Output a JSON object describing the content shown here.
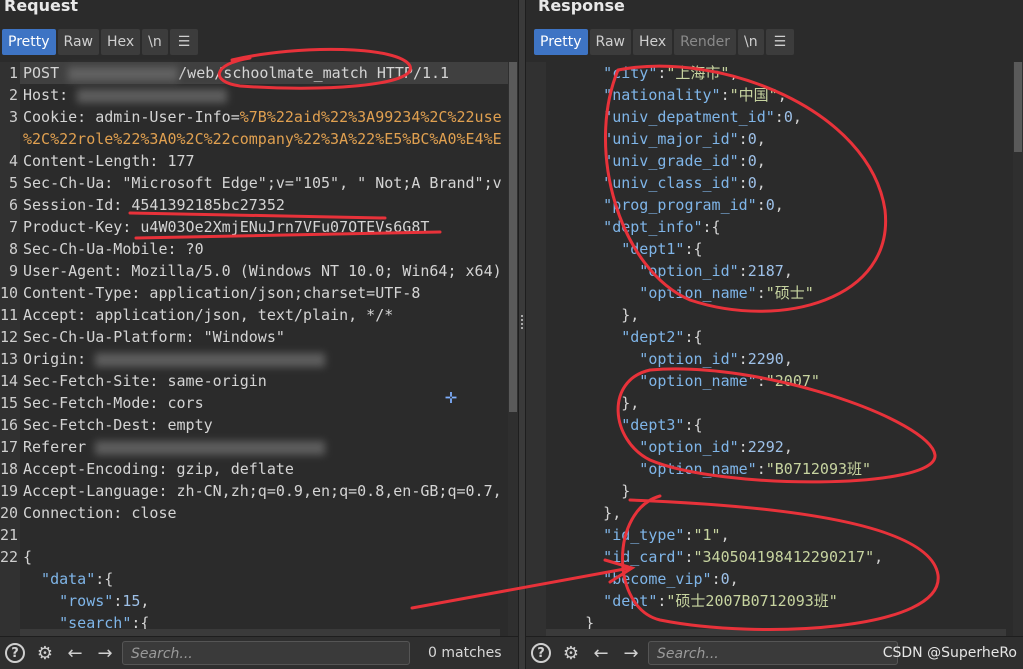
{
  "request": {
    "title": "Request",
    "tabs": [
      "Pretty",
      "Raw",
      "Hex",
      "\\n"
    ],
    "lines": [
      {
        "n": "1",
        "segs": [
          {
            "t": "POST ",
            "c": "k-red"
          },
          {
            "blur": 110
          },
          {
            "t": "/web/schoolmate_match HTTP/1.1",
            "c": "k-red"
          }
        ]
      },
      {
        "n": "2",
        "segs": [
          {
            "t": "Host: ",
            "c": "k-red"
          },
          {
            "blur": 150
          }
        ]
      },
      {
        "n": "3",
        "segs": [
          {
            "t": "Cookie: ",
            "c": "k-red"
          },
          {
            "t": "admin-User-Info=",
            "c": "k-red"
          },
          {
            "t": "%7B%22aid%22%3A99234%2C%22use",
            "c": "k-orange"
          }
        ]
      },
      {
        "n": "",
        "segs": [
          {
            "t": "%2C%22role%22%3A0%2C%22company%22%3A%22%E5%BC%A0%E4%E",
            "c": "k-orange"
          }
        ]
      },
      {
        "n": "4",
        "segs": [
          {
            "t": "Content-Length: 177",
            "c": "k-red"
          }
        ]
      },
      {
        "n": "5",
        "segs": [
          {
            "t": "Sec-Ch-Ua: ",
            "c": "k-red"
          },
          {
            "t": "\"Microsoft Edge\";v=\"105\", \" Not;A Brand\";v",
            "c": "k-red"
          }
        ]
      },
      {
        "n": "6",
        "segs": [
          {
            "t": "Session-Id: ",
            "c": "k-red"
          },
          {
            "t": "4541392185bc27352",
            "c": "k-red"
          }
        ]
      },
      {
        "n": "7",
        "segs": [
          {
            "t": "Product-Key: ",
            "c": "k-red"
          },
          {
            "t": "u4W03Oe2XmjENuJrn7VFu07OTEVs6G8T",
            "c": "k-red"
          }
        ]
      },
      {
        "n": "8",
        "segs": [
          {
            "t": "Sec-Ch-Ua-Mobile: ?0",
            "c": "k-red"
          }
        ]
      },
      {
        "n": "9",
        "segs": [
          {
            "t": "User-Agent: Mozilla/5.0 (Windows NT 10.0; Win64; x64)",
            "c": "k-red"
          }
        ]
      },
      {
        "n": "10",
        "segs": [
          {
            "t": "Content-Type: application/json;charset=UTF-8",
            "c": "k-red"
          }
        ]
      },
      {
        "n": "11",
        "segs": [
          {
            "t": "Accept: application/json, text/plain, */*",
            "c": "k-red"
          }
        ]
      },
      {
        "n": "12",
        "segs": [
          {
            "t": "Sec-Ch-Ua-Platform: \"Windows\"",
            "c": "k-red"
          }
        ]
      },
      {
        "n": "13",
        "segs": [
          {
            "t": "Origin: ",
            "c": "k-red"
          },
          {
            "blur": 230
          }
        ]
      },
      {
        "n": "14",
        "segs": [
          {
            "t": "Sec-Fetch-Site: same-origin",
            "c": "k-red"
          }
        ]
      },
      {
        "n": "15",
        "segs": [
          {
            "t": "Sec-Fetch-Mode: cors",
            "c": "k-red"
          }
        ]
      },
      {
        "n": "16",
        "segs": [
          {
            "t": "Sec-Fetch-Dest: empty",
            "c": "k-red"
          }
        ]
      },
      {
        "n": "17",
        "segs": [
          {
            "t": "Referer ",
            "c": "k-red"
          },
          {
            "blur": 230
          }
        ]
      },
      {
        "n": "18",
        "segs": [
          {
            "t": "Accept-Encoding: gzip, deflate",
            "c": "k-red"
          }
        ]
      },
      {
        "n": "19",
        "segs": [
          {
            "t": "Accept-Language: zh-CN,zh;q=0.9,en;q=0.8,en-GB;q=0.7,",
            "c": "k-red"
          }
        ]
      },
      {
        "n": "20",
        "segs": [
          {
            "t": "Connection: close",
            "c": "k-red"
          }
        ]
      },
      {
        "n": "21",
        "segs": []
      },
      {
        "n": "22",
        "segs": [
          {
            "t": "{",
            "c": "k-red"
          }
        ]
      },
      {
        "n": "",
        "segs": [
          {
            "t": "  \"data\"",
            "c": "k-key"
          },
          {
            "t": ":{",
            "c": "k-red"
          }
        ]
      },
      {
        "n": "",
        "segs": [
          {
            "t": "    \"rows\"",
            "c": "k-key"
          },
          {
            "t": ":",
            "c": "k-red"
          },
          {
            "t": "15",
            "c": "k-num"
          },
          {
            "t": ",",
            "c": "k-red"
          }
        ]
      },
      {
        "n": "",
        "segs": [
          {
            "t": "    \"search\"",
            "c": "k-key"
          },
          {
            "t": ":{",
            "c": "k-red"
          }
        ]
      }
    ],
    "search_placeholder": "Search...",
    "matches": "0 matches"
  },
  "response": {
    "title": "Response",
    "tabs": [
      "Pretty",
      "Raw",
      "Hex",
      "Render",
      "\\n"
    ],
    "lines": [
      {
        "n": "",
        "segs": [
          {
            "t": "      \"city\"",
            "c": "k-key"
          },
          {
            "t": ":",
            "c": "k-red"
          },
          {
            "t": "\"上海市\"",
            "c": "k-str"
          },
          {
            "t": ",",
            "c": "k-red"
          }
        ]
      },
      {
        "n": "",
        "segs": [
          {
            "t": "      \"nationality\"",
            "c": "k-key"
          },
          {
            "t": ":",
            "c": "k-red"
          },
          {
            "t": "\"中国\"",
            "c": "k-str"
          },
          {
            "t": ",",
            "c": "k-red"
          }
        ]
      },
      {
        "n": "",
        "segs": [
          {
            "t": "      \"univ_depatment_id\"",
            "c": "k-key"
          },
          {
            "t": ":",
            "c": "k-red"
          },
          {
            "t": "0",
            "c": "k-num"
          },
          {
            "t": ",",
            "c": "k-red"
          }
        ]
      },
      {
        "n": "",
        "segs": [
          {
            "t": "      \"univ_major_id\"",
            "c": "k-key"
          },
          {
            "t": ":",
            "c": "k-red"
          },
          {
            "t": "0",
            "c": "k-num"
          },
          {
            "t": ",",
            "c": "k-red"
          }
        ]
      },
      {
        "n": "",
        "segs": [
          {
            "t": "      \"univ_grade_id\"",
            "c": "k-key"
          },
          {
            "t": ":",
            "c": "k-red"
          },
          {
            "t": "0",
            "c": "k-num"
          },
          {
            "t": ",",
            "c": "k-red"
          }
        ]
      },
      {
        "n": "",
        "segs": [
          {
            "t": "      \"univ_class_id\"",
            "c": "k-key"
          },
          {
            "t": ":",
            "c": "k-red"
          },
          {
            "t": "0",
            "c": "k-num"
          },
          {
            "t": ",",
            "c": "k-red"
          }
        ]
      },
      {
        "n": "",
        "segs": [
          {
            "t": "      \"prog_program_id\"",
            "c": "k-key"
          },
          {
            "t": ":",
            "c": "k-red"
          },
          {
            "t": "0",
            "c": "k-num"
          },
          {
            "t": ",",
            "c": "k-red"
          }
        ]
      },
      {
        "n": "",
        "segs": [
          {
            "t": "      \"dept_info\"",
            "c": "k-key"
          },
          {
            "t": ":{",
            "c": "k-red"
          }
        ]
      },
      {
        "n": "",
        "segs": [
          {
            "t": "        \"dept1\"",
            "c": "k-key"
          },
          {
            "t": ":{",
            "c": "k-red"
          }
        ]
      },
      {
        "n": "",
        "segs": [
          {
            "t": "          \"option_id\"",
            "c": "k-key"
          },
          {
            "t": ":",
            "c": "k-red"
          },
          {
            "t": "2187",
            "c": "k-num"
          },
          {
            "t": ",",
            "c": "k-red"
          }
        ]
      },
      {
        "n": "",
        "segs": [
          {
            "t": "          \"option_name\"",
            "c": "k-key"
          },
          {
            "t": ":",
            "c": "k-red"
          },
          {
            "t": "\"硕士\"",
            "c": "k-str"
          }
        ]
      },
      {
        "n": "",
        "segs": [
          {
            "t": "        },",
            "c": "k-red"
          }
        ]
      },
      {
        "n": "",
        "segs": [
          {
            "t": "        \"dept2\"",
            "c": "k-key"
          },
          {
            "t": ":{",
            "c": "k-red"
          }
        ]
      },
      {
        "n": "",
        "segs": [
          {
            "t": "          \"option_id\"",
            "c": "k-key"
          },
          {
            "t": ":",
            "c": "k-red"
          },
          {
            "t": "2290",
            "c": "k-num"
          },
          {
            "t": ",",
            "c": "k-red"
          }
        ]
      },
      {
        "n": "",
        "segs": [
          {
            "t": "          \"option_name\"",
            "c": "k-key"
          },
          {
            "t": ":",
            "c": "k-red"
          },
          {
            "t": "\"2007\"",
            "c": "k-str"
          }
        ]
      },
      {
        "n": "",
        "segs": [
          {
            "t": "        },",
            "c": "k-red"
          }
        ]
      },
      {
        "n": "",
        "segs": [
          {
            "t": "        \"dept3\"",
            "c": "k-key"
          },
          {
            "t": ":{",
            "c": "k-red"
          }
        ]
      },
      {
        "n": "",
        "segs": [
          {
            "t": "          \"option_id\"",
            "c": "k-key"
          },
          {
            "t": ":",
            "c": "k-red"
          },
          {
            "t": "2292",
            "c": "k-num"
          },
          {
            "t": ",",
            "c": "k-red"
          }
        ]
      },
      {
        "n": "",
        "segs": [
          {
            "t": "          \"option_name\"",
            "c": "k-key"
          },
          {
            "t": ":",
            "c": "k-red"
          },
          {
            "t": "\"B0712093班\"",
            "c": "k-str"
          }
        ]
      },
      {
        "n": "",
        "segs": [
          {
            "t": "        }",
            "c": "k-red"
          }
        ]
      },
      {
        "n": "",
        "segs": [
          {
            "t": "      },",
            "c": "k-red"
          }
        ]
      },
      {
        "n": "",
        "segs": [
          {
            "t": "      \"id_type\"",
            "c": "k-key"
          },
          {
            "t": ":",
            "c": "k-red"
          },
          {
            "t": "\"1\"",
            "c": "k-str"
          },
          {
            "t": ",",
            "c": "k-red"
          }
        ]
      },
      {
        "n": "",
        "segs": [
          {
            "t": "      \"id_card\"",
            "c": "k-key"
          },
          {
            "t": ":",
            "c": "k-red"
          },
          {
            "t": "\"340504198412290217\"",
            "c": "k-str"
          },
          {
            "t": ",",
            "c": "k-red"
          }
        ]
      },
      {
        "n": "",
        "segs": [
          {
            "t": "      \"become_vip\"",
            "c": "k-key"
          },
          {
            "t": ":",
            "c": "k-red"
          },
          {
            "t": "0",
            "c": "k-num"
          },
          {
            "t": ",",
            "c": "k-red"
          }
        ]
      },
      {
        "n": "",
        "segs": [
          {
            "t": "      \"dept\"",
            "c": "k-key"
          },
          {
            "t": ":",
            "c": "k-red"
          },
          {
            "t": "\"硕士2007B0712093班\"",
            "c": "k-str"
          }
        ]
      },
      {
        "n": "",
        "segs": [
          {
            "t": "    }",
            "c": "k-red"
          }
        ]
      }
    ],
    "search_placeholder": "Search...",
    "matches": ""
  },
  "icons": {
    "help": "help-icon",
    "settings": "gear-icon",
    "prev": "arrow-left-icon",
    "next": "arrow-right-icon",
    "menu": "hamburger-icon"
  },
  "watermark": "CSDN @SuperheRo",
  "colors": {
    "accent": "#3e74c4",
    "annotation": "#e8323a"
  }
}
